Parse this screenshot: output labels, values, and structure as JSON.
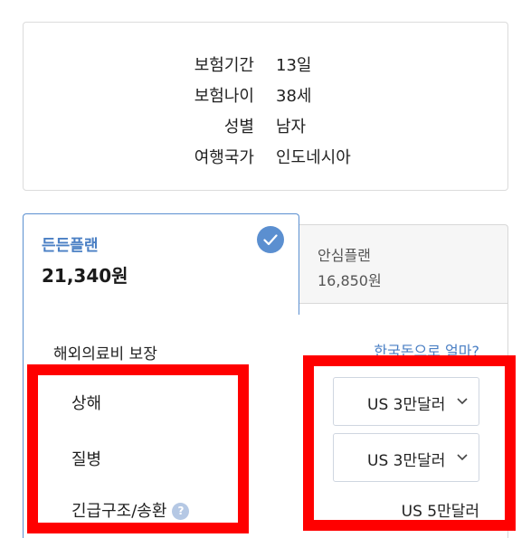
{
  "summary": {
    "rows": [
      {
        "label": "보험기간",
        "value": "13일"
      },
      {
        "label": "보험나이",
        "value": "38세"
      },
      {
        "label": "성별",
        "value": "남자"
      },
      {
        "label": "여행국가",
        "value": "인도네시아"
      }
    ]
  },
  "plans": {
    "active": {
      "name": "든든플랜",
      "price": "21,340원"
    },
    "inactive": {
      "name": "안심플랜",
      "price": "16,850원"
    }
  },
  "coverage": {
    "section_title": "해외의료비 보장",
    "krw_link": "한국돈으로 얼마?",
    "items": [
      {
        "label": "상해",
        "value": "US 3만달러"
      },
      {
        "label": "질병",
        "value": "US 3만달러"
      },
      {
        "label": "긴급구조/송환",
        "value": "US 5만달러"
      }
    ],
    "help_icon_glyph": "?"
  },
  "colors": {
    "accent": "#5b8fd0",
    "highlight": "#ff0000"
  }
}
